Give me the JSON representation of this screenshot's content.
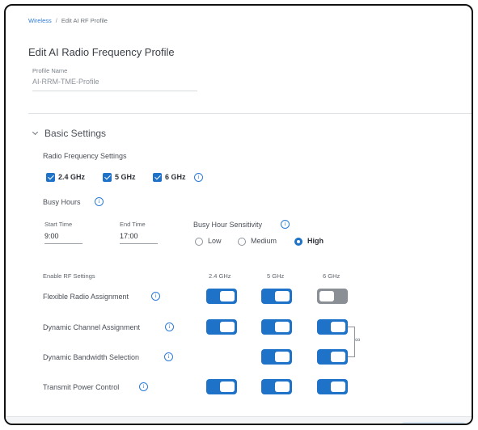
{
  "breadcrumb": {
    "parent": "Wireless",
    "separator": "/",
    "current": "Edit AI RF Profile"
  },
  "page": {
    "title": "Edit AI Radio Frequency Profile"
  },
  "profile": {
    "name_label": "Profile Name",
    "name_value": "AI-RRM-TME-Profile"
  },
  "basic_settings": {
    "title": "Basic Settings",
    "rf_settings_label": "Radio Frequency Settings",
    "bands": [
      {
        "label": "2.4 GHz",
        "checked": true
      },
      {
        "label": "5 GHz",
        "checked": true
      },
      {
        "label": "6 GHz",
        "checked": true
      }
    ],
    "info_glyph": "i",
    "busy_hours": {
      "label": "Busy Hours",
      "start_label": "Start Time",
      "start_value": "9:00",
      "end_label": "End Time",
      "end_value": "17:00",
      "sensitivity_label": "Busy Hour Sensitivity",
      "options": [
        "Low",
        "Medium",
        "High"
      ],
      "selected": "High"
    },
    "enable_rf": {
      "label": "Enable RF Settings",
      "columns": [
        "2.4 GHz",
        "5 GHz",
        "6 GHz"
      ],
      "rows": [
        {
          "label": "Flexible Radio Assignment",
          "toggles": [
            true,
            true,
            false
          ]
        },
        {
          "label": "Dynamic Channel Assignment",
          "toggles": [
            true,
            true,
            true
          ]
        },
        {
          "label": "Dynamic Bandwidth Selection",
          "toggles": [
            null,
            true,
            true
          ]
        },
        {
          "label": "Transmit Power Control",
          "toggles": [
            true,
            true,
            true
          ]
        }
      ]
    }
  },
  "colors": {
    "accent": "#1e73c9",
    "link": "#2d7bd6",
    "toggle_off": "#8a8f95"
  },
  "icons": {
    "info": "info-icon",
    "expand": "chevron-down-icon",
    "link": "link-icon"
  }
}
